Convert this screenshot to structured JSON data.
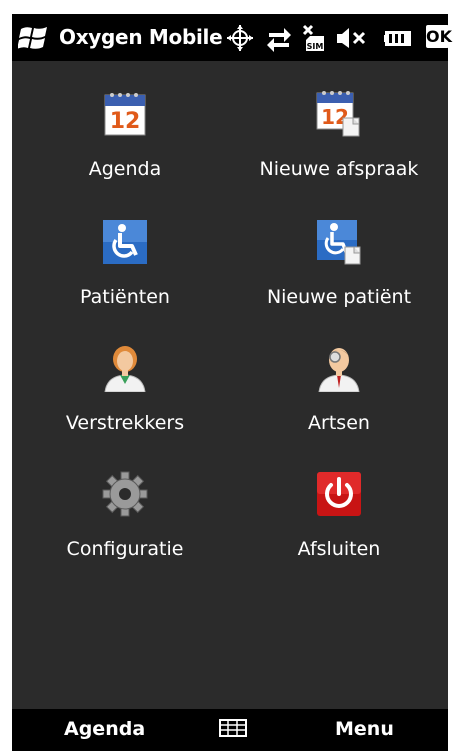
{
  "titlebar": {
    "app_title": "Oxygen Mobile",
    "ok_label": "OK",
    "status_icons": [
      "windows-flag-icon",
      "gps-icon",
      "sync-arrows-icon",
      "no-sim-icon",
      "speaker-mute-icon",
      "battery-icon"
    ]
  },
  "menu": {
    "items": [
      {
        "label": "Agenda",
        "icon": "calendar-icon"
      },
      {
        "label": "Nieuwe afspraak",
        "icon": "new-appointment-icon"
      },
      {
        "label": "Patiënten",
        "icon": "wheelchair-icon"
      },
      {
        "label": "Nieuwe patiënt",
        "icon": "new-patient-icon"
      },
      {
        "label": "Verstrekkers",
        "icon": "nurse-icon"
      },
      {
        "label": "Artsen",
        "icon": "doctor-icon"
      },
      {
        "label": "Configuratie",
        "icon": "gear-icon"
      },
      {
        "label": "Afsluiten",
        "icon": "power-icon"
      }
    ],
    "calendar_day": "12"
  },
  "softkeys": {
    "left": "Agenda",
    "right": "Menu",
    "center_icon": "keyboard-icon"
  },
  "colors": {
    "background": "#2b2b2b",
    "bar": "#000000",
    "power_red": "#c81414",
    "wheelchair_blue": "#2b6cc4"
  }
}
